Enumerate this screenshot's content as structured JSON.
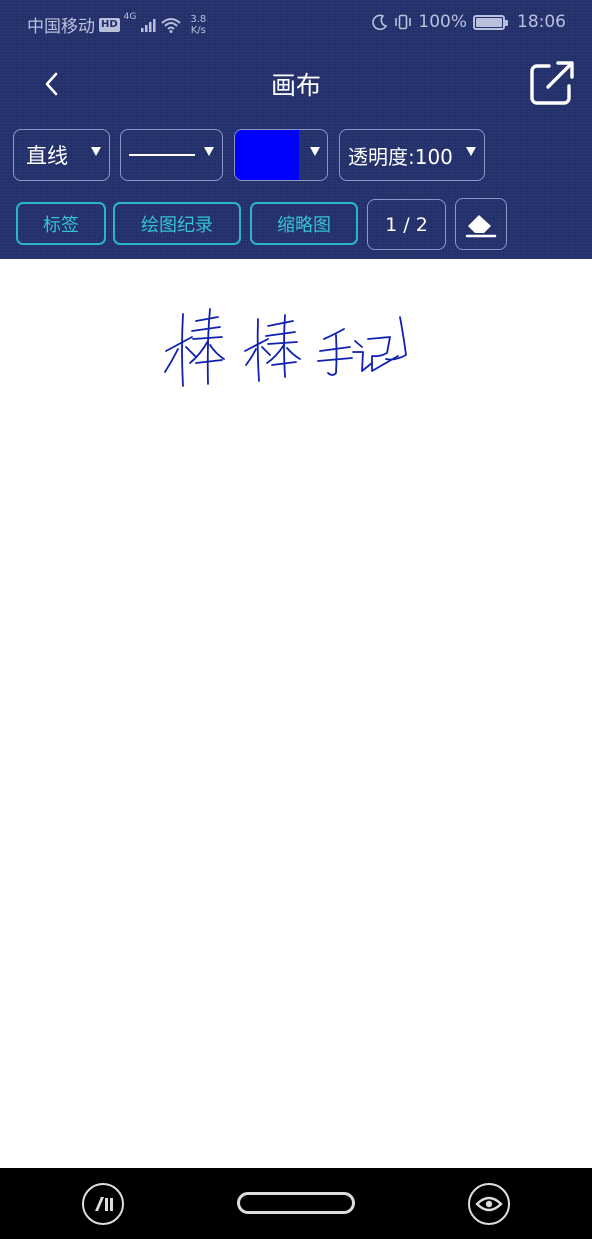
{
  "status_bar": {
    "carrier": "中国移动",
    "hd": "HD",
    "network": "4G",
    "speed_value": "3.8",
    "speed_unit": "K/s",
    "battery": "100%",
    "time": "18:06"
  },
  "header": {
    "title": "画布",
    "back_icon": "chevron-left-icon",
    "share_icon": "share-external-icon"
  },
  "toolbar": {
    "shape_selected": "直线",
    "line_style_selected": "solid-line",
    "color_selected": "#0000ff",
    "opacity_label": "透明度:100",
    "tag_label": "标签",
    "record_label": "绘图纪录",
    "thumbnail_label": "缩略图",
    "page_indicator": "1 / 2",
    "eraser_icon": "eraser-icon"
  },
  "canvas": {
    "stroke_color": "#1020b0"
  },
  "colors": {
    "header_bg": "#232f6b",
    "accent_teal": "#2bb6c6",
    "border_muted": "#8e96c9"
  }
}
